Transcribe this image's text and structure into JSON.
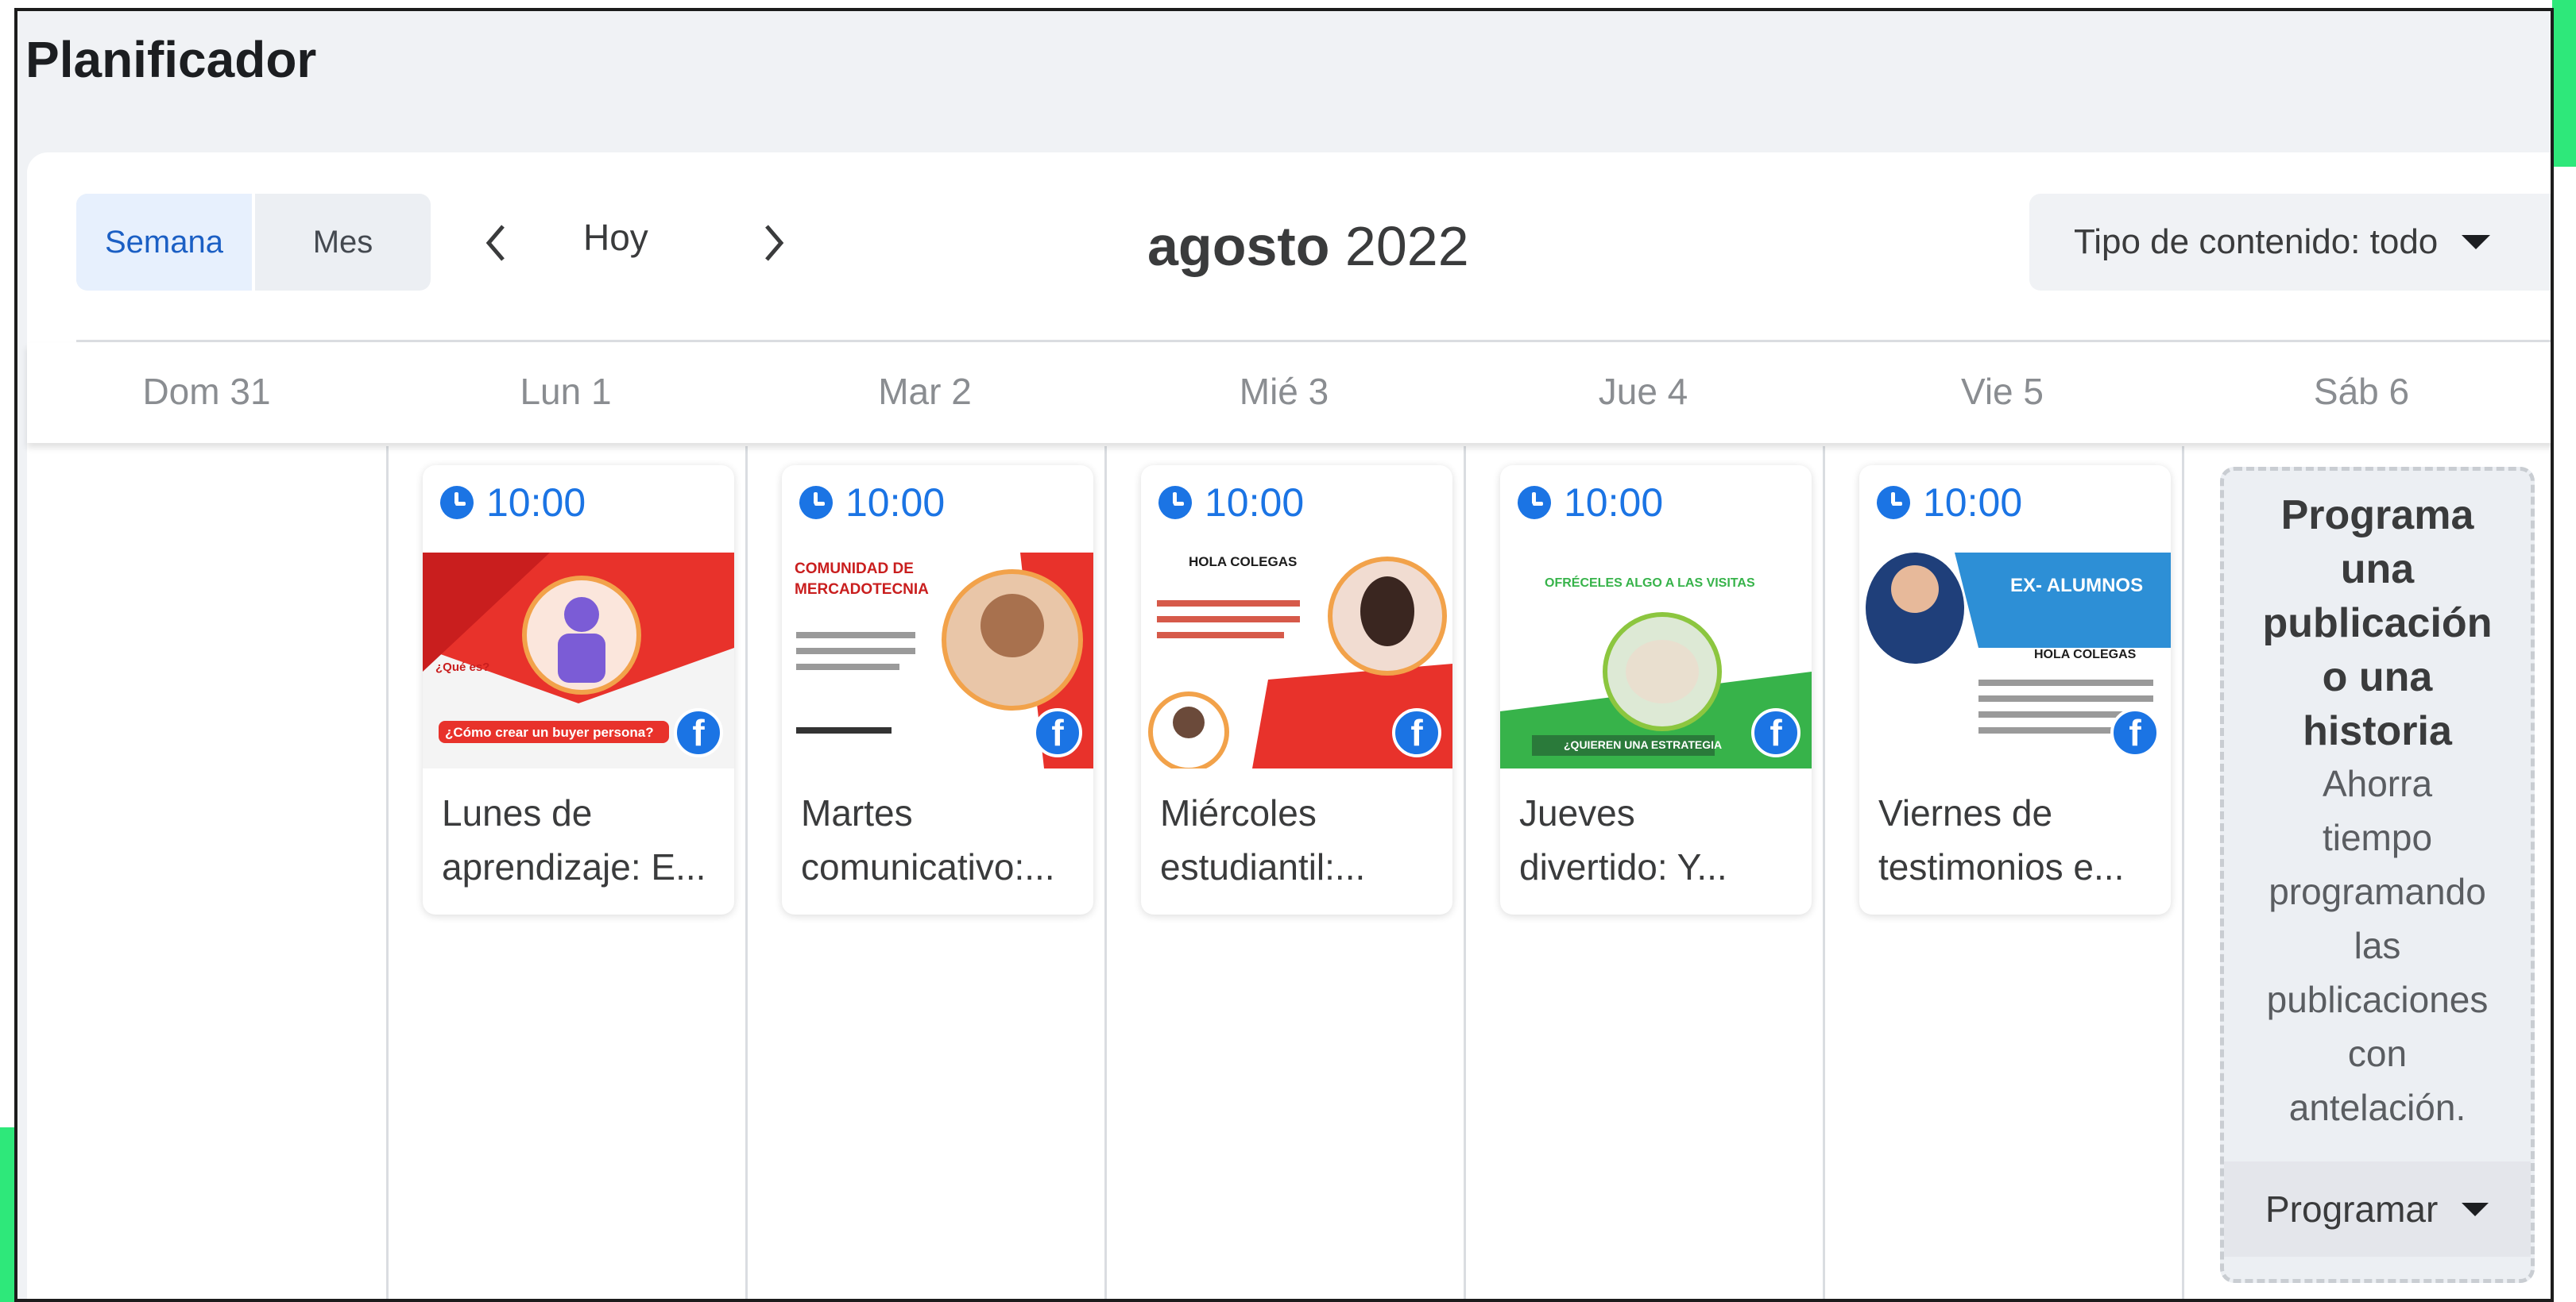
{
  "app": {
    "title": "Planificador"
  },
  "toolbar": {
    "view_week": "Semana",
    "view_month": "Mes",
    "today": "Hoy",
    "month": "agosto",
    "year": "2022",
    "content_filter": "Tipo de contenido: todo"
  },
  "days": [
    "Dom 31",
    "Lun 1",
    "Mar 2",
    "Mié 3",
    "Jue 4",
    "Vie 5",
    "Sáb 6"
  ],
  "posts": [
    {
      "day": "Lun 1",
      "time": "10:00",
      "caption_line1": "Lunes de",
      "caption_line2": "aprendizaje: E...",
      "thumb_text1": "¿Qué es?",
      "thumb_text2": "¿Cómo crear un buyer persona?",
      "platform_icon": "facebook-icon"
    },
    {
      "day": "Mar 2",
      "time": "10:00",
      "caption_line1": "Martes",
      "caption_line2": "comunicativo:...",
      "thumb_text1": "COMUNIDAD DE",
      "thumb_text2": "MERCADOTECNIA",
      "platform_icon": "facebook-icon"
    },
    {
      "day": "Mié 3",
      "time": "10:00",
      "caption_line1": "Miércoles",
      "caption_line2": "estudiantil:...",
      "thumb_text1": "HOLA COLEGAS",
      "thumb_text2": "",
      "platform_icon": "facebook-icon"
    },
    {
      "day": "Jue 4",
      "time": "10:00",
      "caption_line1": "Jueves",
      "caption_line2": "divertido: Y...",
      "thumb_text1": "OFRÉCELES ALGO A LAS VISITAS",
      "thumb_text2": "¿QUIEREN UNA ESTRATEGIA",
      "platform_icon": "facebook-icon"
    },
    {
      "day": "Vie 5",
      "time": "10:00",
      "caption_line1": "Viernes de",
      "caption_line2": "testimonios e...",
      "thumb_text1": "EX- ALUMNOS",
      "thumb_text2": "HOLA COLEGAS",
      "platform_icon": "facebook-icon"
    }
  ],
  "schedule_prompt": {
    "title_lines": [
      "Programa",
      "una",
      "publicación",
      "o una",
      "historia"
    ],
    "text_lines": [
      "Ahorra",
      "tiempo",
      "programando",
      "las",
      "publicaciones",
      "con",
      "antelación."
    ],
    "button": "Programar"
  },
  "colors": {
    "accent": "#1b74e4",
    "page_bg": "#f0f2f5",
    "active_view_bg": "#e7f0fd"
  }
}
